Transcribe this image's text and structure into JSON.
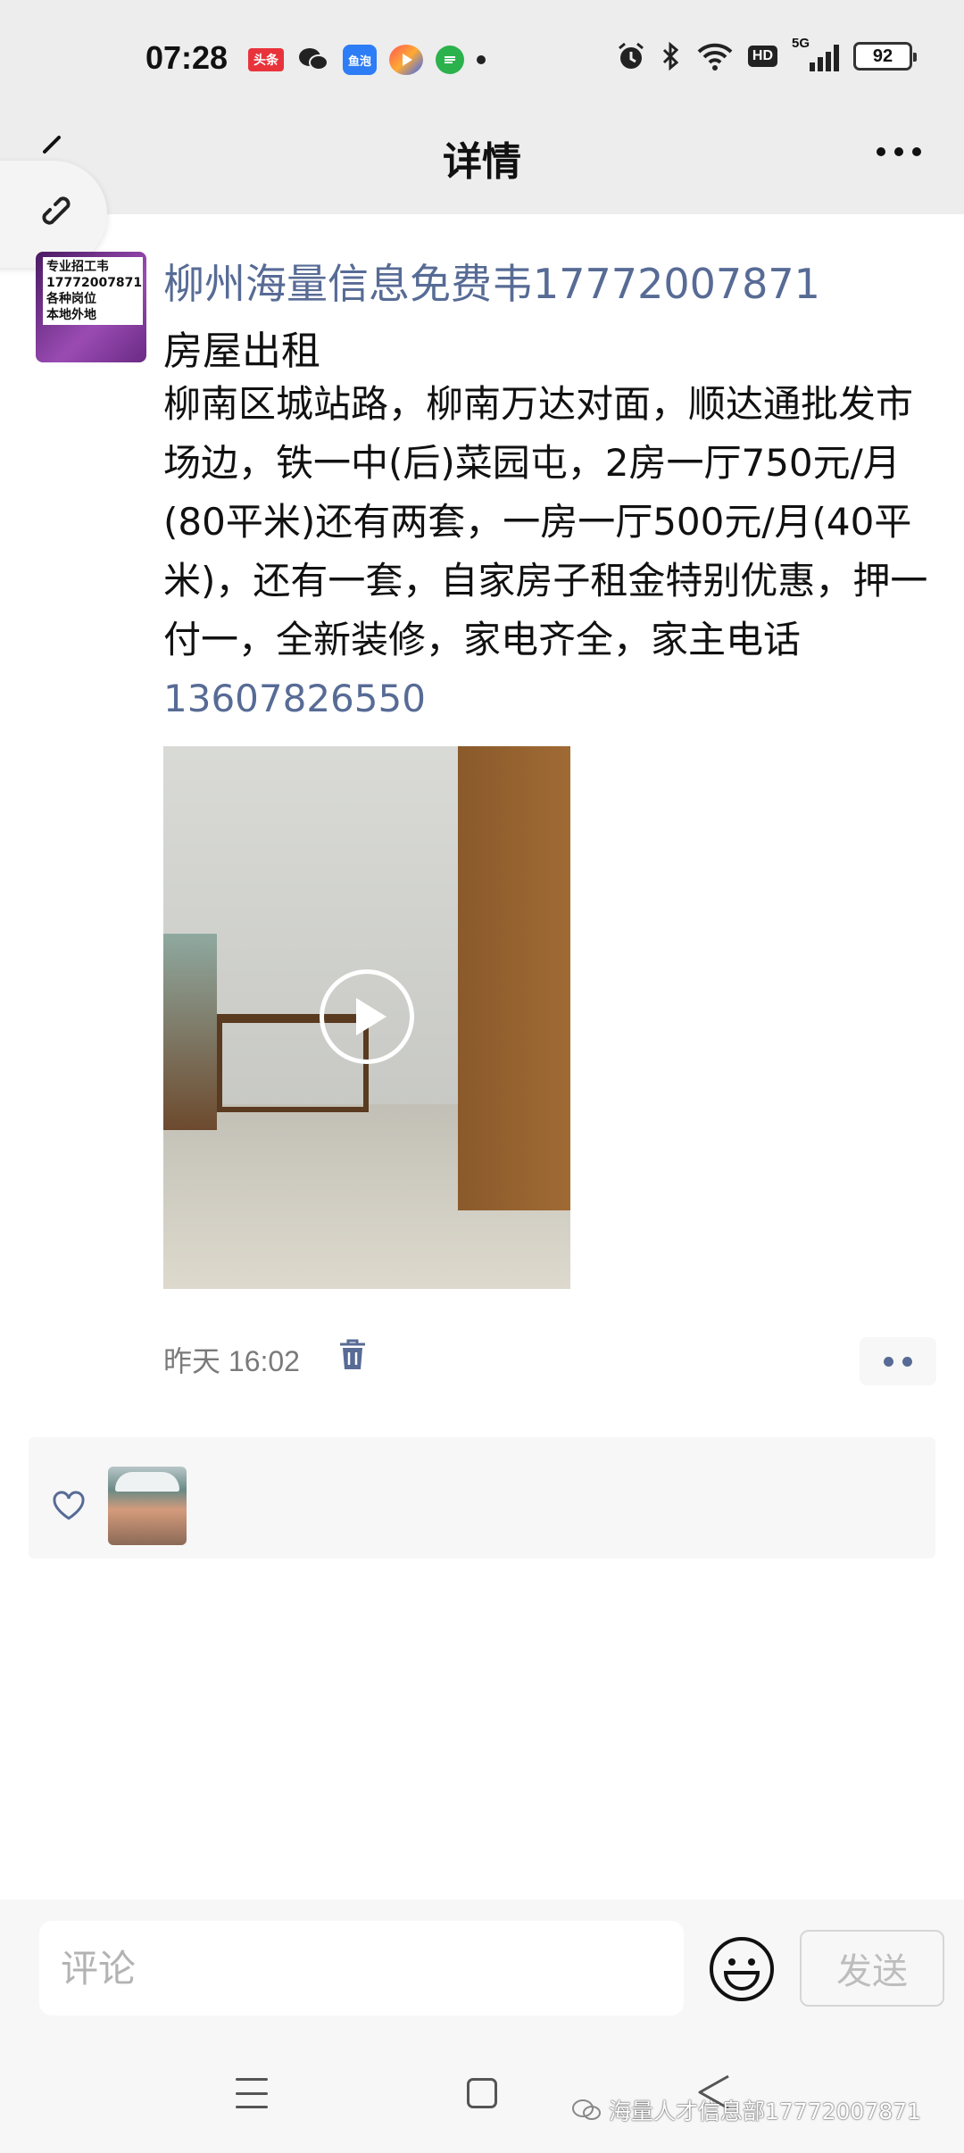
{
  "status_bar": {
    "time": "07:28",
    "app_badges": [
      "头条",
      "鱼泡"
    ],
    "battery": "92",
    "network": "5G",
    "hd_label": "HD"
  },
  "header": {
    "title": "详情"
  },
  "post": {
    "avatar_lines": [
      "专业招工韦",
      "17772007871",
      "各种岗位",
      "本地外地"
    ],
    "author": "柳州海量信息免费韦17772007871",
    "heading": "房屋出租",
    "body_text": "柳南区城站路，柳南万达对面，顺达通批发市场边，铁一中(后)菜园屯，2房一厅750元/月(80平米)还有两套，一房一厅500元/月(40平米)，还有一套，自家房子租金特别优惠，押一付一，全新装修，家电齐全，家主电话",
    "phone": "13607826550",
    "time": "昨天 16:02"
  },
  "comment": {
    "placeholder": "评论",
    "send_label": "发送"
  },
  "watermark": {
    "text": "海量人才信息部17772007871"
  },
  "colors": {
    "link_blue": "#576b95",
    "header_bg": "#ededed"
  }
}
